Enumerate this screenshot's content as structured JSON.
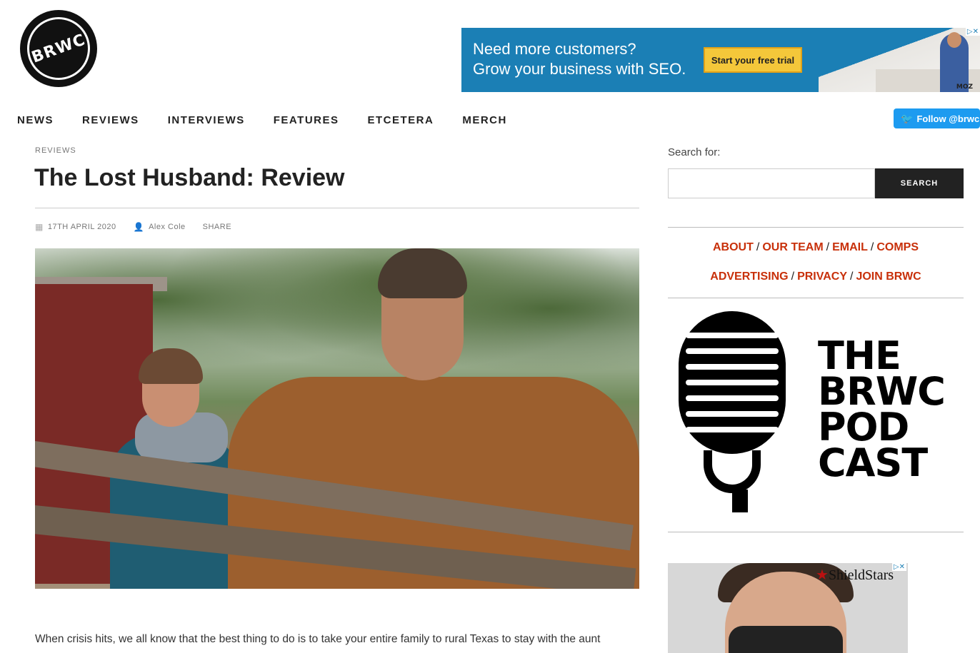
{
  "site": {
    "logo_text": "BRWC"
  },
  "top_ad": {
    "line1": "Need more customers?",
    "line2": "Grow your business with SEO.",
    "cta": "Start your free trial",
    "brand": "MOZ",
    "adchoice": "▷✕"
  },
  "nav": {
    "items": [
      {
        "label": "NEWS"
      },
      {
        "label": "REVIEWS"
      },
      {
        "label": "INTERVIEWS"
      },
      {
        "label": "FEATURES"
      },
      {
        "label": "ETCETERA"
      },
      {
        "label": "MERCH"
      }
    ],
    "follow_label": "Follow @brwc"
  },
  "article": {
    "category": "REVIEWS",
    "title": "The Lost Husband: Review",
    "date": "17TH APRIL 2020",
    "author": "Alex Cole",
    "share": "SHARE",
    "lead": "When crisis hits, we all know that the best thing to do is to take your entire family to rural Texas to stay with the aunt"
  },
  "sidebar": {
    "search_label": "Search for:",
    "search_value": "",
    "search_button": "SEARCH",
    "links_row1": [
      "ABOUT",
      "OUR TEAM",
      "EMAIL",
      "COMPS"
    ],
    "links_row2": [
      "ADVERTISING",
      "PRIVACY",
      "JOIN BRWC"
    ],
    "separator": "/",
    "podcast_lines": [
      "THE",
      "BRWC",
      "POD",
      "CAST"
    ],
    "side_ad_brand": "ShieldStars",
    "side_ad_star": "★"
  },
  "colors": {
    "link_red": "#c8300a",
    "twitter_blue": "#1d9bf0",
    "ad_blue": "#1b7fb5",
    "cta_yellow": "#f4c73a"
  }
}
